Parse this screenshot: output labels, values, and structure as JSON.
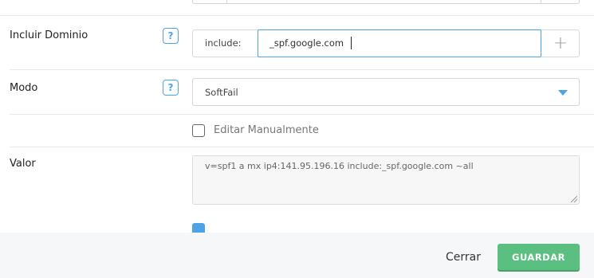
{
  "form": {
    "include_label": "Incluir Dominio",
    "include_prefix": "include:",
    "include_value": "_spf.google.com",
    "mode_label": "Modo",
    "mode_selected": "SoftFail",
    "manual_label": "Editar Manualmente",
    "value_label": "Valor",
    "value_text": "v=spf1 a mx ip4:141.95.196.16 include:_spf.google.com ~all",
    "help_glyph": "?",
    "add_glyph": "+"
  },
  "footer": {
    "cancel_label": "Cerrar",
    "save_label": "GUARDAR"
  },
  "colors": {
    "accent": "#4da3e6",
    "save_button": "#5cbf82"
  }
}
